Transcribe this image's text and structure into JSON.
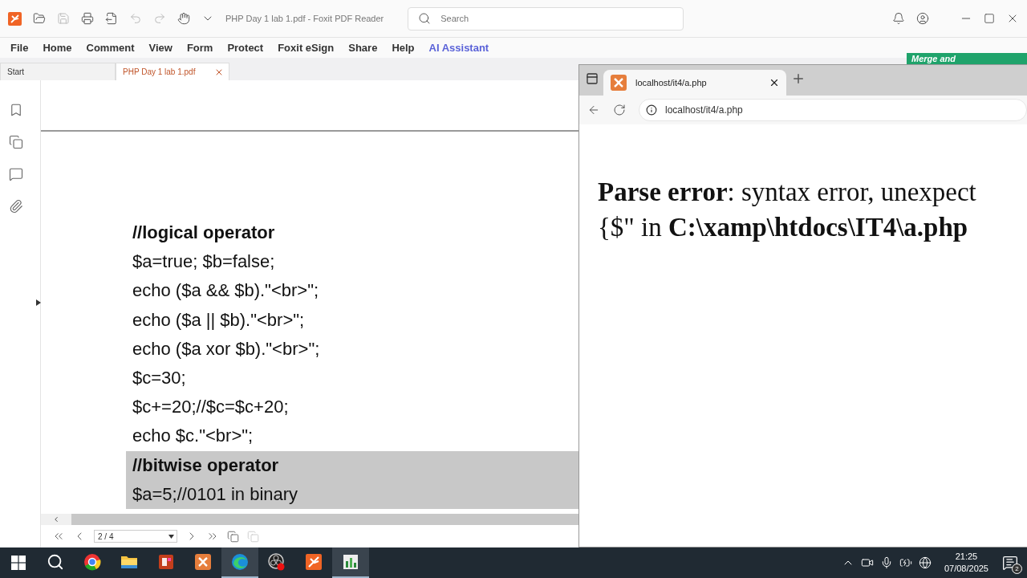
{
  "app": {
    "title": "PHP Day 1 lab 1.pdf - Foxit PDF Reader",
    "search": {
      "placeholder": "Search"
    }
  },
  "menu": [
    {
      "label": "File",
      "kind": "plain"
    },
    {
      "label": "Home",
      "kind": "plain"
    },
    {
      "label": "Comment",
      "kind": "plain"
    },
    {
      "label": "View",
      "kind": "plain"
    },
    {
      "label": "Form",
      "kind": "plain"
    },
    {
      "label": "Protect",
      "kind": "plain"
    },
    {
      "label": "Foxit eSign",
      "kind": "plain"
    },
    {
      "label": "Share",
      "kind": "plain"
    },
    {
      "label": "Help",
      "kind": "plain"
    },
    {
      "label": "AI Assistant",
      "kind": "ai"
    }
  ],
  "doc_tabs": [
    {
      "label": "Start",
      "selected": false,
      "closable": false
    },
    {
      "label": "PHP Day 1 lab 1.pdf",
      "selected": true,
      "closable": true
    }
  ],
  "banner": {
    "text": "Merge and"
  },
  "document_lines": [
    {
      "text": "//logical operator",
      "kind": "comment",
      "selected": false
    },
    {
      "text": "$a=true; $b=false;",
      "kind": "code",
      "selected": false
    },
    {
      "text": "echo ($a && $b).\"<br>\";",
      "kind": "code",
      "selected": false
    },
    {
      "text": "echo ($a || $b).\"<br>\";",
      "kind": "code",
      "selected": false
    },
    {
      "text": "echo ($a xor $b).\"<br>\";",
      "kind": "code",
      "selected": false
    },
    {
      "text": "$c=30;",
      "kind": "code",
      "selected": false
    },
    {
      "text": "$c+=20;//$c=$c+20;",
      "kind": "code",
      "selected": false
    },
    {
      "text": "echo $c.\"<br>\";",
      "kind": "code",
      "selected": false
    },
    {
      "text": "//bitwise operator",
      "kind": "comment",
      "selected": true
    },
    {
      "text": "$a=5;//0101 in binary",
      "kind": "code",
      "selected": true
    }
  ],
  "page_nav": {
    "page": "2 / 4"
  },
  "browser": {
    "tab": "localhost/it4/a.php",
    "url": "localhost/it4/a.php",
    "lines": [
      "**Parse error**: syntax error, unexpect",
      "{$\" in **C:\\xamp\\htdocs\\IT4\\a.php**"
    ]
  },
  "taskbar": {
    "apps": [
      {
        "kind": "chrome",
        "active": false
      },
      {
        "kind": "folder",
        "active": false
      },
      {
        "kind": "powerpoint",
        "active": false
      },
      {
        "kind": "xampp",
        "active": false
      },
      {
        "kind": "edge",
        "active": true
      },
      {
        "kind": "obs",
        "active": false
      },
      {
        "kind": "foxit",
        "active": false
      },
      {
        "kind": "chart",
        "active": true
      }
    ],
    "time": "21:25",
    "date": "07/08/2025",
    "notifications": "2"
  }
}
